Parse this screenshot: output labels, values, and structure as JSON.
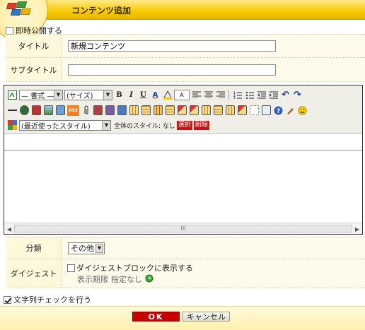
{
  "window": {
    "title": "コンテンツ追加"
  },
  "publish_now": {
    "label": "即時公開する",
    "checked": false
  },
  "fields": {
    "title": {
      "label": "タイトル",
      "value": "新規コンテンツ"
    },
    "subtitle": {
      "label": "サブタイトル",
      "value": ""
    }
  },
  "editor": {
    "format_select": "— 書式 —",
    "size_select": "(サイズ)",
    "style_select": "(最近使ったスタイル)",
    "global_style_label": "全体のスタイル: なし",
    "select_button": "選択",
    "delete_button": "削除",
    "scroll_grip": "III"
  },
  "category": {
    "label": "分類",
    "value": "その他"
  },
  "digest": {
    "label": "ダイジェスト",
    "checkbox_label": "ダイジェストブロックに表示する",
    "period_label": "表示期限",
    "period_value": "指定なし"
  },
  "string_check": {
    "label": "文字列チェックを行う",
    "checked": true
  },
  "footer": {
    "ok_label": "OK",
    "cancel_label": "キャンセル"
  },
  "colors": {
    "title_bar": "#f7c900",
    "ok": "#c80000",
    "row_bg": "#fffbea",
    "label_bg": "#fff8dd"
  }
}
